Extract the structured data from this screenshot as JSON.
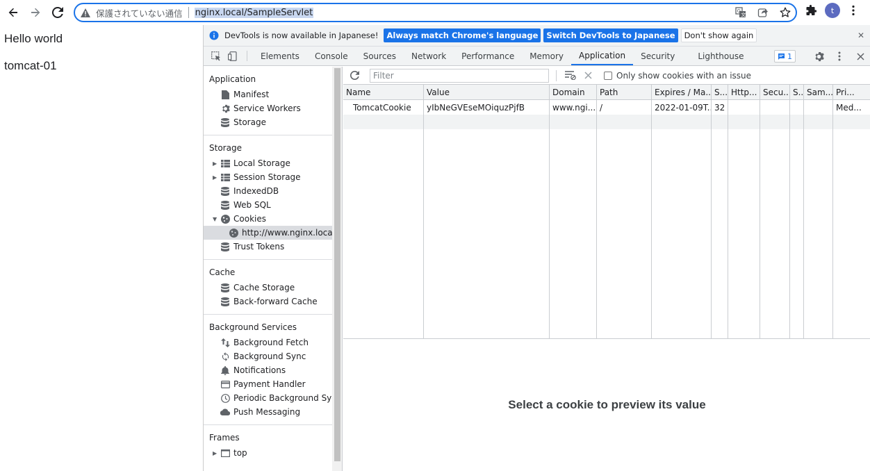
{
  "browser": {
    "security_text": "保護されていない通信",
    "url": "nginx.local/SampleServlet",
    "avatar_letter": "t"
  },
  "page": {
    "line1": "Hello world",
    "line2": "tomcat-01"
  },
  "infobar": {
    "message": "DevTools is now available in Japanese!",
    "btn_match": "Always match Chrome's language",
    "btn_switch": "Switch DevTools to Japanese",
    "btn_dismiss": "Don't show again"
  },
  "tabs": [
    "Elements",
    "Console",
    "Sources",
    "Network",
    "Performance",
    "Memory",
    "Application",
    "Security",
    "Lighthouse"
  ],
  "active_tab": "Application",
  "issues_count": "1",
  "sidebar": {
    "application": {
      "title": "Application",
      "items": [
        "Manifest",
        "Service Workers",
        "Storage"
      ]
    },
    "storage": {
      "title": "Storage",
      "items": [
        "Local Storage",
        "Session Storage",
        "IndexedDB",
        "Web SQL",
        "Cookies",
        "http://www.nginx.local",
        "Trust Tokens"
      ]
    },
    "cache": {
      "title": "Cache",
      "items": [
        "Cache Storage",
        "Back-forward Cache"
      ]
    },
    "background": {
      "title": "Background Services",
      "items": [
        "Background Fetch",
        "Background Sync",
        "Notifications",
        "Payment Handler",
        "Periodic Background Sync",
        "Push Messaging"
      ]
    },
    "frames": {
      "title": "Frames",
      "items": [
        "top"
      ]
    }
  },
  "cookies_toolbar": {
    "filter_placeholder": "Filter",
    "issue_label": "Only show cookies with an issue"
  },
  "cookie_table": {
    "headers": [
      "Name",
      "Value",
      "Domain",
      "Path",
      "Expires / Ma...",
      "S...",
      "Http...",
      "Secu...",
      "S...",
      "Sam...",
      "Pri..."
    ],
    "row": [
      "TomcatCookie",
      "yIbNeGVEseMOiquzPjfB",
      "www.ngi...",
      "/",
      "2022-01-09T...",
      "32",
      "",
      "",
      "",
      "",
      "Med..."
    ]
  },
  "preview_text": "Select a cookie to preview its value",
  "colors": {
    "accent": "#1a73e8",
    "selected_bg": "#dadce0"
  }
}
